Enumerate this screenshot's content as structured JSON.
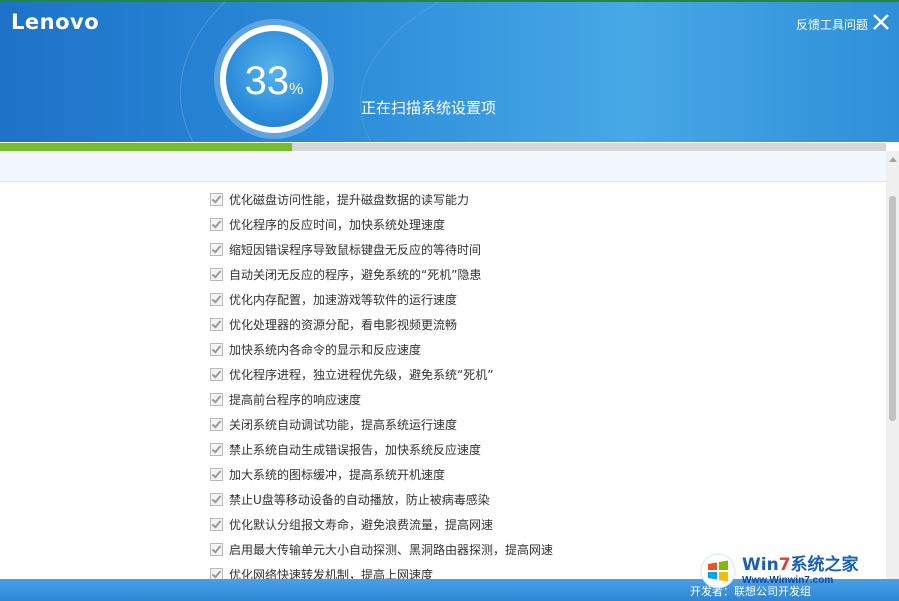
{
  "header": {
    "logo_text": "Lenovo",
    "feedback_label": "反馈工具问题",
    "status_text": "正在扫描系统设置项",
    "progress": {
      "value": 33,
      "sign": "%",
      "fraction": 0.33
    },
    "colors": {
      "header_blue": "#2a8ad8",
      "progress_green": "#76bd2c"
    }
  },
  "items": [
    {
      "label": "优化磁盘访问性能，提升磁盘数据的读写能力",
      "checked": true
    },
    {
      "label": "优化程序的反应时间，加快系统处理速度",
      "checked": true
    },
    {
      "label": "缩短因错误程序导致鼠标键盘无反应的等待时间",
      "checked": true
    },
    {
      "label": "自动关闭无反应的程序，避免系统的“死机”隐患",
      "checked": true
    },
    {
      "label": "优化内存配置，加速游戏等软件的运行速度",
      "checked": true
    },
    {
      "label": "优化处理器的资源分配，看电影视频更流畅",
      "checked": true
    },
    {
      "label": "加快系统内各命令的显示和反应速度",
      "checked": true
    },
    {
      "label": "优化程序进程，独立进程优先级，避免系统“死机”",
      "checked": true
    },
    {
      "label": "提高前台程序的响应速度",
      "checked": true
    },
    {
      "label": "关闭系统自动调试功能，提高系统运行速度",
      "checked": true
    },
    {
      "label": "禁止系统自动生成错误报告，加快系统反应速度",
      "checked": true
    },
    {
      "label": "加大系统的图标缓冲，提高系统开机速度",
      "checked": true
    },
    {
      "label": "禁止U盘等移动设备的自动播放，防止被病毒感染",
      "checked": true
    },
    {
      "label": "优化默认分组报文寿命，避免浪费流量，提高网速",
      "checked": true
    },
    {
      "label": "启用最大传输单元大小自动探测、黑洞路由器探测，提高网速",
      "checked": true
    },
    {
      "label": "优化网络快速转发机制，提高上网速度",
      "checked": true
    }
  ],
  "footer": {
    "text": "开发者：联想公司开发组"
  },
  "watermark": {
    "title_prefix": "Win",
    "title_seven": "7",
    "title_suffix": "系统之家",
    "url": "Www.Winwin7.com"
  }
}
